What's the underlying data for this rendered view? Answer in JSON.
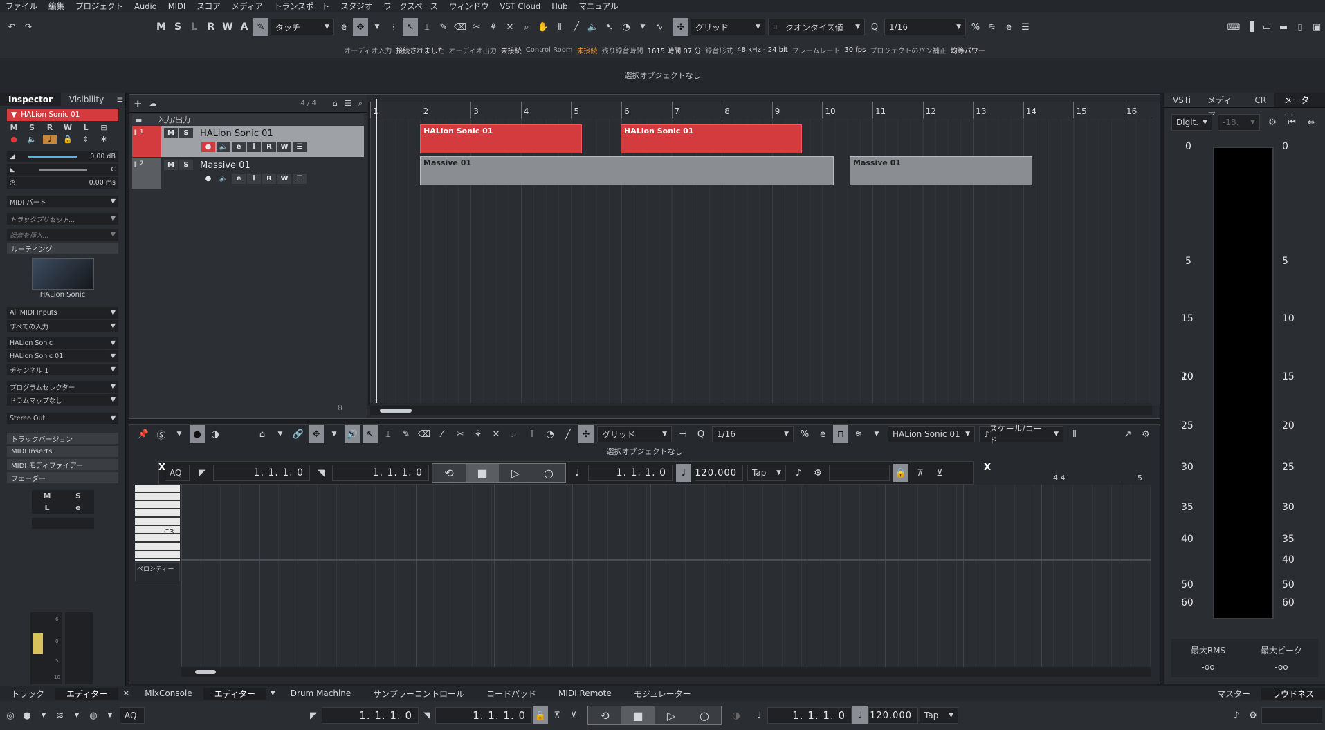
{
  "menu": [
    "ファイル",
    "編集",
    "プロジェクト",
    "Audio",
    "MIDI",
    "スコア",
    "メディア",
    "トランスポート",
    "スタジオ",
    "ワークスペース",
    "ウィンドウ",
    "VST Cloud",
    "Hub",
    "マニュアル"
  ],
  "toolbar": {
    "mswraq": [
      "M",
      "S",
      "L",
      "R",
      "W",
      "A"
    ],
    "automation_mode": "タッチ",
    "snap_label": "グリッド",
    "quantize_label": "クオンタイズ値",
    "quantize_value": "1/16"
  },
  "status": {
    "audio_in_label": "オーディオ入力",
    "audio_in_value": "接続されました",
    "audio_out_label": "オーディオ出力",
    "audio_out_value": "未接続",
    "control_room_label": "Control Room",
    "control_room_value": "未接続",
    "rec_time_label": "残り録音時間",
    "rec_time_value": "1615 時間 07 分",
    "rec_format_label": "録音形式",
    "rec_format_value": "48 kHz - 24 bit",
    "framerate_label": "フレームレート",
    "framerate_value": "30 fps",
    "pan_label": "プロジェクトのパン補正",
    "pan_value": "均等パワー"
  },
  "info_line": "選択オブジェクトなし",
  "inspector": {
    "tabs": [
      "Inspector",
      "Visibility"
    ],
    "track_name": "HALion Sonic 01",
    "volume": "0.00 dB",
    "pan": "C",
    "delay": "0.00 ms",
    "midi_part": "MIDI パート",
    "preset": "トラックプリセット...",
    "insert": "録音を挿入...",
    "routing": "ルーティング",
    "instrument_name": "HALion Sonic",
    "midi_in": "All MIDI Inputs",
    "all_inputs": "すべての入力",
    "output": "HALion Sonic",
    "output2": "HALion Sonic 01",
    "channel": "チャンネル 1",
    "program": "プログラムセレクター",
    "drum_map": "ドラムマップなし",
    "stereo_out": "Stereo Out",
    "sections": [
      "トラックバージョン",
      "MIDI Inserts",
      "MIDI モディファイアー",
      "フェーダー"
    ],
    "fader_labels": [
      "M",
      "S",
      "L",
      "e"
    ],
    "fader_scale": [
      "6",
      "0",
      "5",
      "10"
    ]
  },
  "tracks": {
    "counter": "4 / 4",
    "folder": "入力/出力",
    "list": [
      {
        "num": "1",
        "name": "HALion Sonic 01"
      },
      {
        "num": "2",
        "name": "Massive 01"
      }
    ]
  },
  "ruler": [
    "1",
    "2",
    "3",
    "4",
    "5",
    "6",
    "7",
    "8",
    "9",
    "10",
    "11",
    "12",
    "13",
    "14",
    "15",
    "16"
  ],
  "parts": [
    {
      "name": "HALion Sonic 01"
    },
    {
      "name": "HALion Sonic 01"
    },
    {
      "name": "Massive 01"
    },
    {
      "name": "Massive 01"
    }
  ],
  "editor": {
    "snap": "グリッド",
    "quantize": "1/16",
    "instrument": "HALion Sonic 01",
    "scale": "スケール/コード",
    "info": "選択オブジェクトなし",
    "aq": "AQ",
    "pos1": "1. 1. 1.   0",
    "pos2": "1. 1. 1.   0",
    "pos3": "1. 1. 1.   0",
    "tempo": "120.000",
    "tap": "Tap",
    "ruler_mark": "4.4",
    "ruler_end": "5",
    "c3": "C3",
    "velocity": "ベロシティー"
  },
  "meter": {
    "tabs": [
      "VSTi",
      "メディア",
      "CR",
      "メーター"
    ],
    "mode": "Digit.",
    "value": "-18.",
    "scale": [
      "0",
      "5",
      "10",
      "15",
      "20",
      "25",
      "30",
      "35",
      "40",
      "50",
      "60"
    ],
    "rms_label": "最大RMS",
    "peak_label": "最大ピーク",
    "rms_value": "-oo",
    "peak_value": "-oo",
    "bottom_tabs": [
      "マスター",
      "ラウドネス"
    ]
  },
  "bottom_tabs": [
    "トラック",
    "エディター",
    "MixConsole",
    "エディター",
    "Drum Machine",
    "サンプラーコントロール",
    "コードパッド",
    "MIDI Remote",
    "モジュレーター"
  ],
  "transport": {
    "aq": "AQ",
    "left": "1. 1. 1.   0",
    "right": "1. 1. 1.   0",
    "pos": "1. 1. 1.   0",
    "tempo": "120.000",
    "tap": "Tap"
  },
  "colors": {
    "accent": "#d43b3f",
    "midi_part": "#d43b3f",
    "instrument_part": "#8a8d92"
  }
}
